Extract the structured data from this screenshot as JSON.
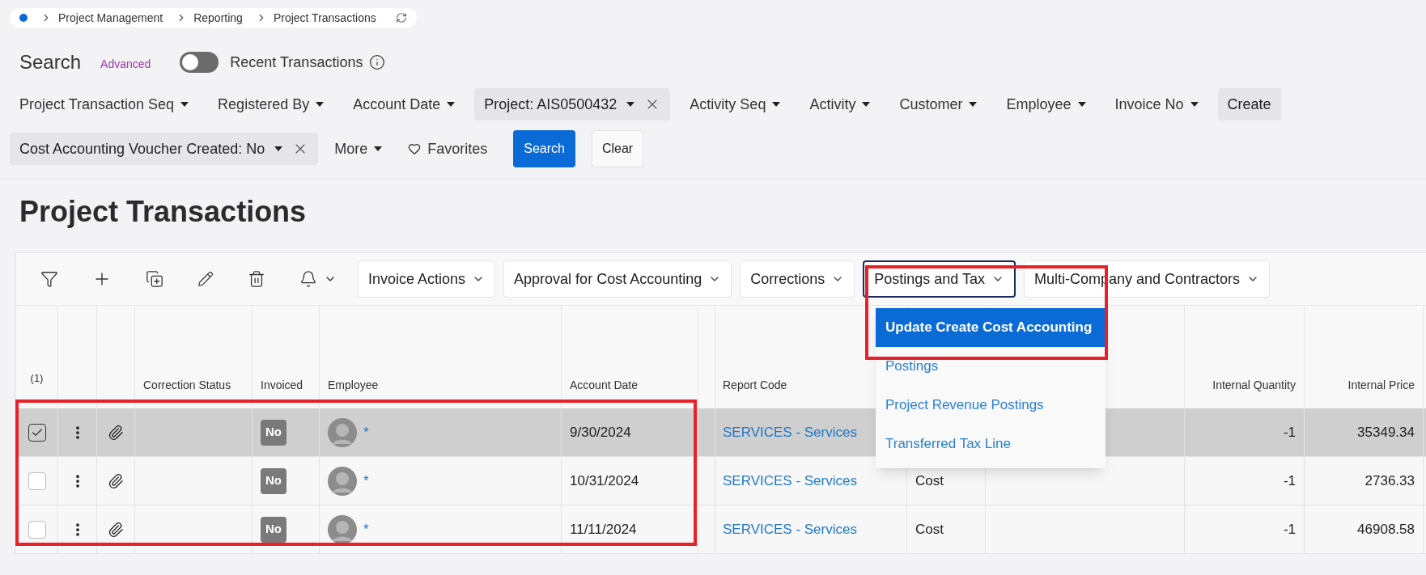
{
  "breadcrumb": {
    "items": [
      "Project Management",
      "Reporting",
      "Project Transactions"
    ]
  },
  "search": {
    "title": "Search",
    "advanced": "Advanced",
    "toggle": {
      "label": "Recent Transactions",
      "on": false
    }
  },
  "filters_row_1": [
    {
      "label": "Project Transaction Seq",
      "kind": "dropdown"
    },
    {
      "label": "Registered By",
      "kind": "dropdown"
    },
    {
      "label": "Account Date",
      "kind": "dropdown"
    },
    {
      "label": "Project: AIS0500432",
      "kind": "active"
    },
    {
      "label": "Activity Seq",
      "kind": "dropdown"
    },
    {
      "label": "Activity",
      "kind": "dropdown"
    },
    {
      "label": "Customer",
      "kind": "dropdown"
    },
    {
      "label": "Employee",
      "kind": "dropdown"
    },
    {
      "label": "Invoice No",
      "kind": "dropdown"
    },
    {
      "label": "Create",
      "kind": "cut"
    }
  ],
  "filters_row_2": [
    {
      "label": "Cost Accounting Voucher Created: No",
      "kind": "active"
    },
    {
      "label": "More",
      "kind": "dropdown"
    },
    {
      "label": "Favorites",
      "kind": "favorites"
    }
  ],
  "buttons": [
    {
      "label": "Search",
      "kind": "primary"
    },
    {
      "label": "Clear",
      "kind": "secondary"
    }
  ],
  "page_title": "Project Transactions",
  "actions": [
    {
      "label": "Invoice Actions",
      "open": false
    },
    {
      "label": "Approval for Cost Accounting",
      "open": false
    },
    {
      "label": "Corrections",
      "open": false
    },
    {
      "label": "Postings and Tax",
      "open": true
    },
    {
      "label": "Multi-Company and Contractors",
      "open": false
    }
  ],
  "menu": [
    {
      "label": "Update Create Cost Accounting",
      "selected": true
    },
    {
      "label": "Postings",
      "selected": false
    },
    {
      "label": "Project Revenue Postings",
      "selected": false
    },
    {
      "label": "Transferred Tax Line",
      "selected": false
    }
  ],
  "table": {
    "selected_count": "(1)",
    "columns": [
      "Correction Status",
      "Invoiced",
      "Employee",
      "Account Date",
      "Report Code",
      "Internal Quantity",
      "Internal Price"
    ],
    "rows": [
      {
        "checked": true,
        "invoiced": "No",
        "employee": "*",
        "account_date": "9/30/2024",
        "report_code": "SERVICES - Services",
        "internal_quantity": "-1",
        "internal_price": "35349.34"
      },
      {
        "checked": false,
        "invoiced": "No",
        "employee": "*",
        "account_date": "10/31/2024",
        "report_code": "SERVICES - Services",
        "column_10": "Cost",
        "internal_quantity": "-1",
        "internal_price": "2736.33"
      },
      {
        "checked": false,
        "invoiced": "No",
        "employee": "*",
        "account_date": "11/11/2024",
        "report_code": "SERVICES - Services",
        "column_10": "Cost",
        "internal_quantity": "-1",
        "internal_price": "46908.58"
      }
    ]
  }
}
